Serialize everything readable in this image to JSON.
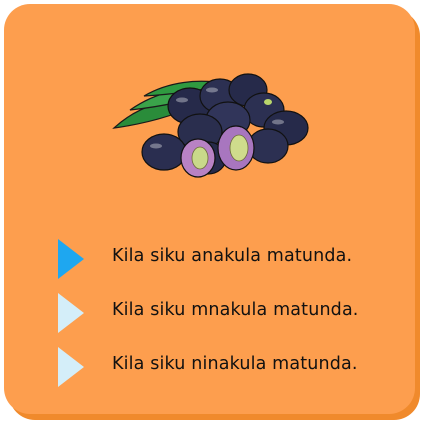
{
  "question_image": {
    "icon": "jamun-fruit-illustration"
  },
  "options": [
    {
      "label": "Kila siku anakula matunda.",
      "selected": true
    },
    {
      "label": "Kila siku mnakula matunda.",
      "selected": false
    },
    {
      "label": "Kila siku ninakula matunda.",
      "selected": false
    }
  ],
  "colors": {
    "card": "#fd9e4e",
    "card_shadow": "#f08a2c",
    "arrow_selected": "#1ea7f0",
    "arrow_default": "#d4eef9"
  }
}
